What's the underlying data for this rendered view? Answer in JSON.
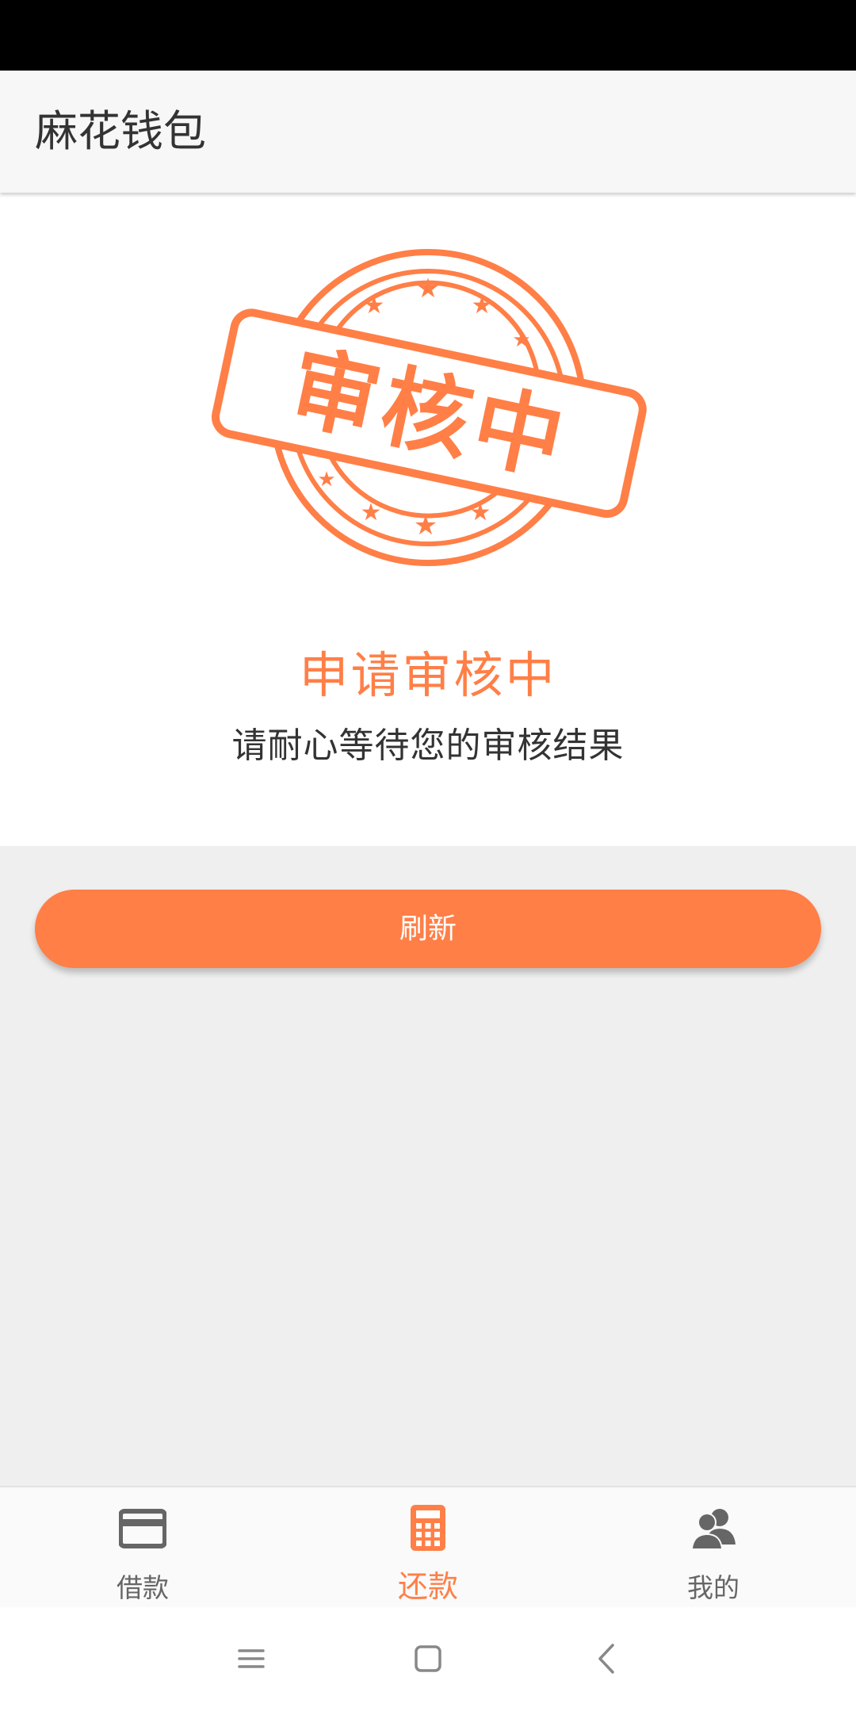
{
  "app": {
    "title": "麻花钱包"
  },
  "status": {
    "stamp_text": "审核中",
    "title": "申请审核中",
    "subtitle": "请耐心等待您的审核结果"
  },
  "actions": {
    "refresh_label": "刷新"
  },
  "bottom_nav": {
    "items": [
      {
        "label": "借款",
        "icon": "credit-card-icon",
        "active": false
      },
      {
        "label": "还款",
        "icon": "calculator-icon",
        "active": true
      },
      {
        "label": "我的",
        "icon": "users-icon",
        "active": false
      }
    ]
  },
  "colors": {
    "accent": "#ff7f47",
    "text_primary": "#333333",
    "nav_inactive": "#666666",
    "page_background": "#efefef"
  }
}
